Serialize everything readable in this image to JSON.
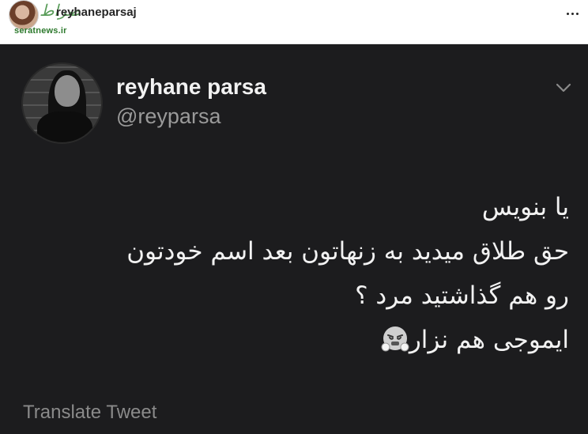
{
  "instagram": {
    "username": "reyhaneparsaj",
    "watermark": "seratnews.ir",
    "watermark_script": "صراط"
  },
  "tweet": {
    "display_name": "reyhane parsa",
    "handle": "@reyparsa",
    "lines": [
      "یا بنویس",
      "حق طلاق میدید به زنهاتون بعد اسم خودتون",
      "رو هم گذاشتید مرد ؟",
      "ایموجی هم نزار"
    ],
    "emoji": "face-with-steam-icon",
    "translate_label": "Translate Tweet"
  },
  "icons": {
    "more": "more-horizontal-icon",
    "chevron": "chevron-down-icon"
  },
  "colors": {
    "tweet_background": "#1c1c1e",
    "tweet_text": "#f2f2f2",
    "secondary_text": "#9a9a9a"
  }
}
